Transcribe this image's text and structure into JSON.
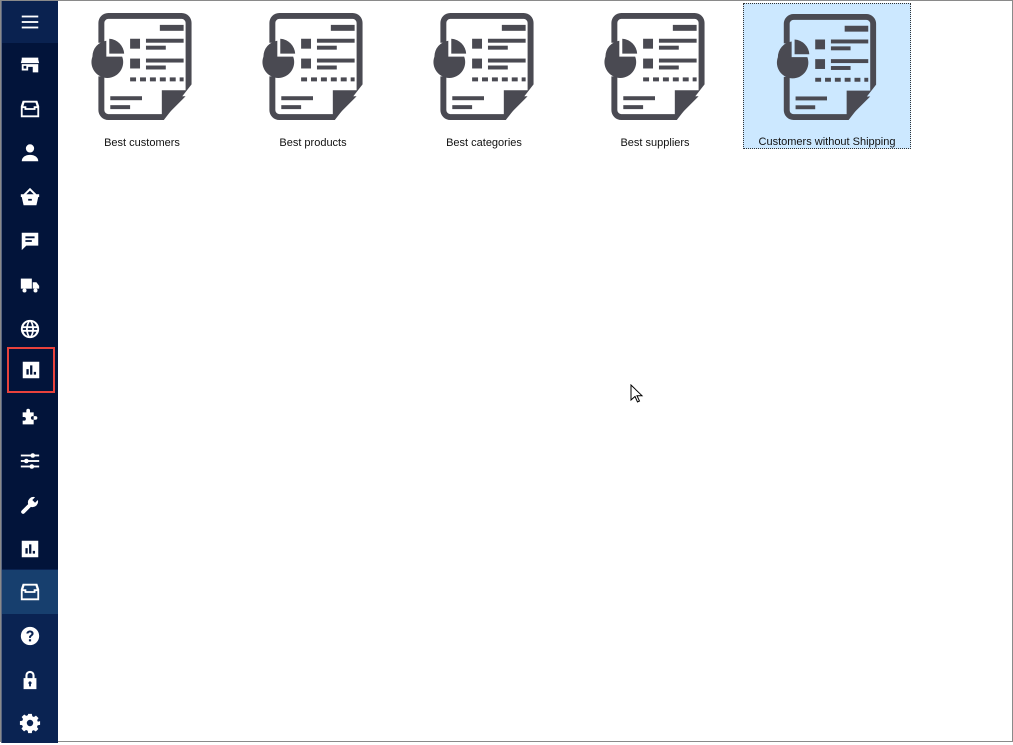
{
  "sidebar": {
    "items": [
      {
        "name": "menu-icon",
        "label": "Menu"
      },
      {
        "name": "store-icon",
        "label": "Store"
      },
      {
        "name": "inbox-icon",
        "label": "Inbox"
      },
      {
        "name": "user-icon",
        "label": "Customers"
      },
      {
        "name": "basket-icon",
        "label": "Orders"
      },
      {
        "name": "chat-icon",
        "label": "Messages"
      },
      {
        "name": "truck-icon",
        "label": "Shipping"
      },
      {
        "name": "globe-icon",
        "label": "Localization"
      },
      {
        "name": "chart-icon",
        "label": "Reports"
      },
      {
        "name": "puzzle-icon",
        "label": "Modules"
      },
      {
        "name": "sliders-icon",
        "label": "Settings"
      },
      {
        "name": "wrench-icon",
        "label": "Tools"
      },
      {
        "name": "chart-icon",
        "label": "Statistics"
      },
      {
        "name": "archive-icon",
        "label": "Archive"
      },
      {
        "name": "help-icon",
        "label": "Help"
      },
      {
        "name": "lock-icon",
        "label": "Lock"
      },
      {
        "name": "gear-icon",
        "label": "Preferences"
      }
    ],
    "highlighted_index": 8,
    "selected_index": 13
  },
  "reports": [
    {
      "label": "Best customers",
      "selected": false
    },
    {
      "label": "Best products",
      "selected": false
    },
    {
      "label": "Best categories",
      "selected": false
    },
    {
      "label": "Best suppliers",
      "selected": false
    },
    {
      "label": "Customers without Shipping",
      "selected": true
    }
  ],
  "colors": {
    "sidebar_bg": "#02143a",
    "selection_bg": "#cce8ff",
    "highlight_outline": "#e8423c",
    "icon_gray": "#4a4a52"
  }
}
